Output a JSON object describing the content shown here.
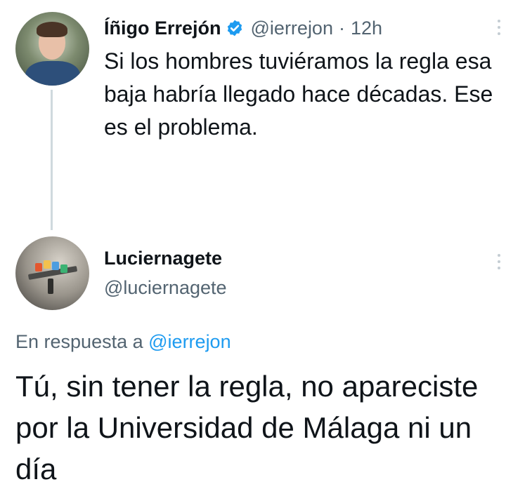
{
  "original_tweet": {
    "display_name": "Íñigo Errejón",
    "handle": "@ierrejon",
    "separator": "·",
    "time": "12h",
    "verified": true,
    "text": "Si los hombres tuviéramos la regla esa baja habría llegado hace décadas. Ese es el problema.",
    "avatar_icon": "profile-photo"
  },
  "reply_tweet": {
    "display_name": "Luciernagete",
    "handle": "@luciernagete",
    "reply_prefix": "En respuesta a",
    "reply_mention": "@ierrejon",
    "text": "Tú, sin tener la regla, no apareciste por la Universidad de Málaga ni un día",
    "avatar_icon": "lego-photo"
  },
  "icons": {
    "verified": "verified-badge-icon",
    "menu": "more-vertical-icon"
  },
  "colors": {
    "text_primary": "#0f1419",
    "text_secondary": "#536471",
    "accent_blue": "#1d9bf0",
    "thread_line": "#cfd9de"
  }
}
